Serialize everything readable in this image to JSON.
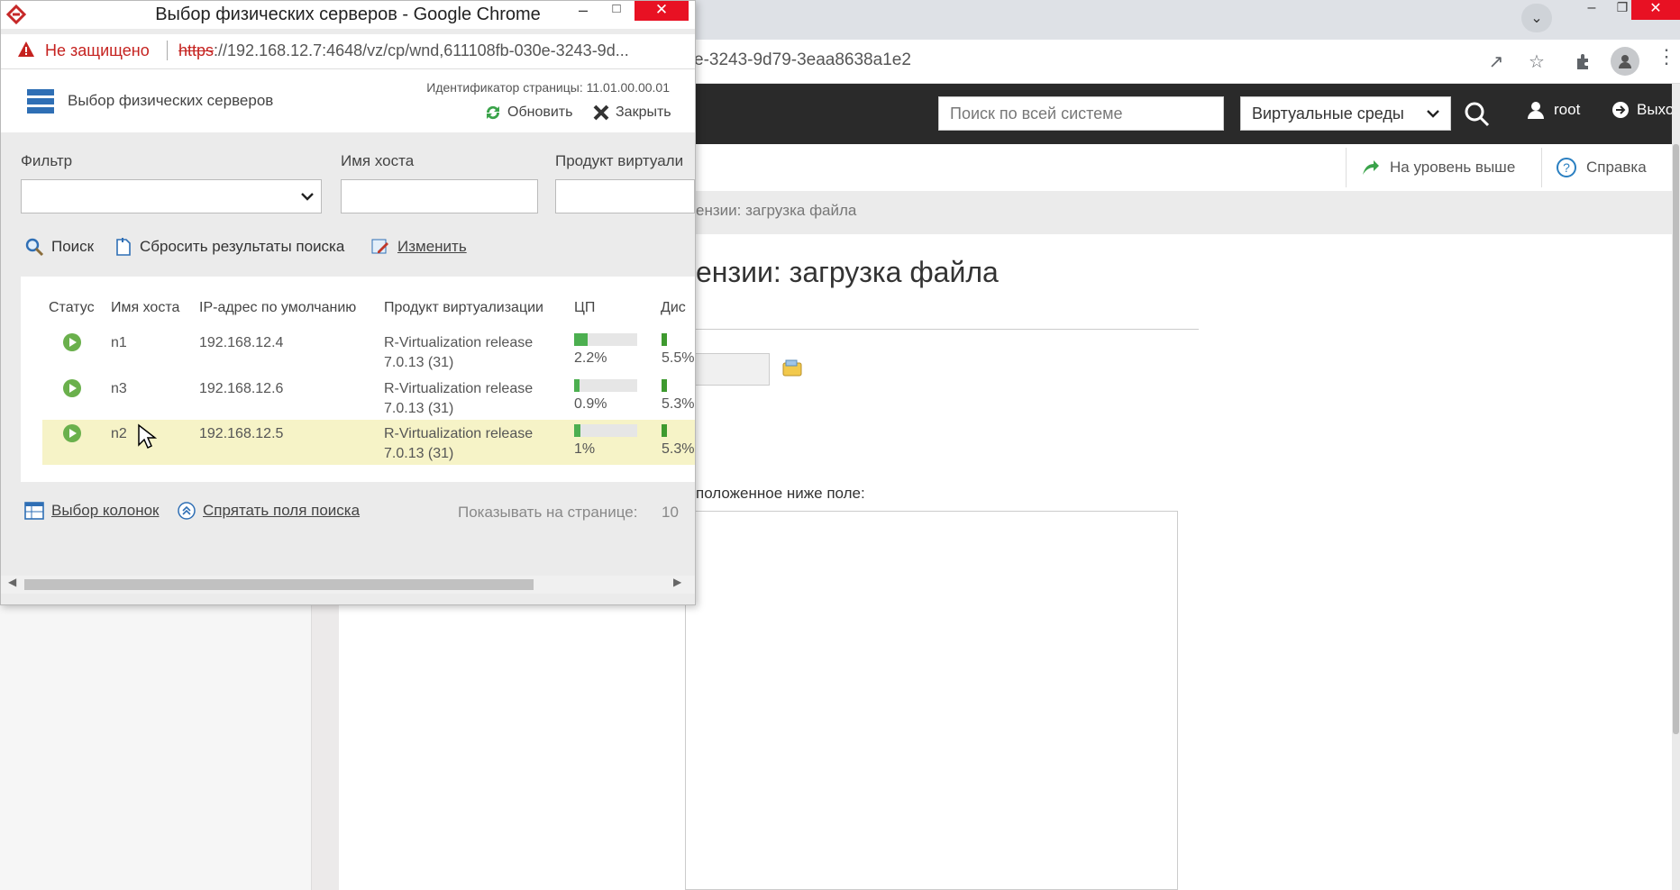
{
  "background_browser": {
    "url_visible": "e-3243-9d79-3eaa8638a1e2"
  },
  "app_header": {
    "search_placeholder": "Поиск по всей системе",
    "env_select_value": "Виртуальные среды",
    "user_name": "root",
    "logout_label": "Выход"
  },
  "app_toolbar": {
    "up_level_label": "На уровень выше",
    "help_label": "Справка"
  },
  "main_content": {
    "breadcrumb_fragment": "ензии: загрузка файла",
    "heading_fragment": "ензии: загрузка файла",
    "field_label_fragment": "положенное ниже поле:"
  },
  "popup": {
    "window_title": "Выбор физических серверов - Google Chrome",
    "security_warning": "Не защищено",
    "url_scheme": "https",
    "url_rest": "://192.168.12.7:4648/vz/cp/wnd,611108fb-030e-3243-9d...",
    "header_title": "Выбор физических серверов",
    "page_id": "Идентификатор страницы: 11.01.00.00.01",
    "refresh_label": "Обновить",
    "close_label": "Закрыть",
    "filters": {
      "filter_label": "Фильтр",
      "hostname_label": "Имя хоста",
      "product_label": "Продукт виртуали",
      "hostname_value": "",
      "product_value": ""
    },
    "actions": {
      "search_label": "Поиск",
      "reset_label": "Сбросить результаты поиска",
      "edit_label": "Изменить"
    },
    "grid": {
      "columns": [
        "Статус",
        "Имя хоста",
        "IP-адрес по умолчанию",
        "Продукт виртуализации",
        "ЦП",
        "Дис"
      ],
      "rows": [
        {
          "status": "running",
          "host": "n1",
          "ip": "192.168.12.4",
          "product_line1": "R-Virtualization release",
          "product_line2": "7.0.13 (31)",
          "cpu": "2.2%",
          "cpu_fraction": 0.022,
          "disk": "5.5%"
        },
        {
          "status": "running",
          "host": "n3",
          "ip": "192.168.12.6",
          "product_line1": "R-Virtualization release",
          "product_line2": "7.0.13 (31)",
          "cpu": "0.9%",
          "cpu_fraction": 0.009,
          "disk": "5.3%"
        },
        {
          "status": "running",
          "host": "n2",
          "ip": "192.168.12.5",
          "product_line1": "R-Virtualization release",
          "product_line2": "7.0.13 (31)",
          "cpu": "1%",
          "cpu_fraction": 0.01,
          "disk": "5.3%",
          "selected": true
        }
      ]
    },
    "footer": {
      "columns_label": "Выбор колонок",
      "hide_search_label": "Спрятать поля поиска",
      "per_page_label": "Показывать на странице:",
      "per_page_value": "10"
    }
  },
  "colors": {
    "header_bg": "#2a2a2a",
    "warning_red": "#c5221f",
    "selected_row": "#f6f3c7",
    "status_green": "#6ab04c"
  }
}
